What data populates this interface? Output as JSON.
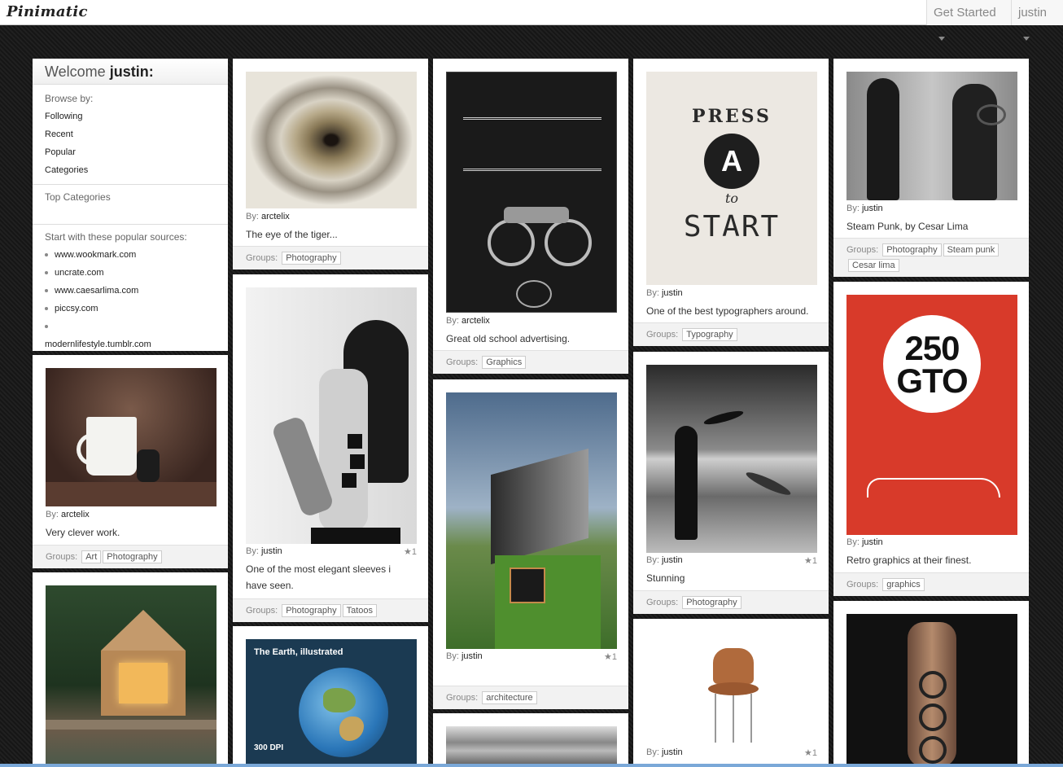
{
  "app": {
    "brand": "Pinimatic",
    "get_started": "Get Started",
    "user_menu": "justin"
  },
  "welcome": {
    "title_prefix": "Welcome",
    "user": "justin:",
    "browse_by": "Browse by:",
    "links": [
      "Following",
      "Recent",
      "Popular",
      "Categories"
    ],
    "top_categories": "Top Categories",
    "sources_heading": "Start with these popular sources:",
    "sources": [
      "www.wookmark.com",
      "uncrate.com",
      "www.caesarlima.com",
      "piccsy.com",
      "",
      "modernlifestyle.tumblr.com"
    ]
  },
  "labels": {
    "by": "By:",
    "groups": "Groups:"
  },
  "pins": [
    {
      "by": "arctelix",
      "desc": "Very clever work.",
      "groups": [
        "Art",
        "Photography"
      ],
      "image": "coffee-mug-photo"
    },
    {
      "by": "arctelix",
      "desc": "The eye of the tiger...",
      "groups": [
        "Photography"
      ],
      "image": "eye-photo"
    },
    {
      "by": "justin",
      "desc": "One of the most elegant sleeves i have seen.",
      "groups": [
        "Photography",
        "Tatoos"
      ],
      "star": "★1",
      "image": "tattoo-woman-photo"
    },
    {
      "by": "arctelix",
      "desc": "Great old school advertising.",
      "groups": [
        "Graphics"
      ],
      "image": "widowmaker-poster"
    },
    {
      "by": "justin",
      "desc": "",
      "groups": [
        "architecture"
      ],
      "star": "★1",
      "image": "modern-house-photo"
    },
    {
      "by": "justin",
      "desc": "One of the best typographers around.",
      "groups": [
        "Typography"
      ],
      "image": "press-a-to-start-poster",
      "poster_text": {
        "top": "PRESS",
        "letter": "A",
        "mid": "to",
        "bottom": "START"
      }
    },
    {
      "by": "justin",
      "desc": "Stunning",
      "groups": [
        "Photography"
      ],
      "star": "★1",
      "image": "woman-with-bird-photo"
    },
    {
      "by": "justin",
      "desc": "",
      "groups": [],
      "star": "★1",
      "image": "chair-photo"
    },
    {
      "by": "justin",
      "desc": "Steam Punk, by Cesar Lima",
      "groups": [
        "Photography",
        "Steam punk",
        "Cesar lima"
      ],
      "image": "steampunk-photo"
    },
    {
      "by": "justin",
      "desc": "Retro graphics at their finest.",
      "groups": [
        "graphics"
      ],
      "image": "250-gto-poster",
      "poster_text": {
        "line1": "250",
        "line2": "GTO"
      }
    },
    {
      "by": "",
      "desc": "",
      "groups": [],
      "image": "cabin-photo"
    },
    {
      "by": "",
      "desc": "",
      "groups": [],
      "image": "earth-infographic",
      "poster_text": {
        "title": "The Earth, illustrated",
        "dpi": "300 DPI"
      }
    },
    {
      "by": "",
      "desc": "",
      "groups": [],
      "image": "machine-photo"
    },
    {
      "by": "",
      "desc": "",
      "groups": [],
      "image": "arm-tattoo-photo"
    }
  ]
}
